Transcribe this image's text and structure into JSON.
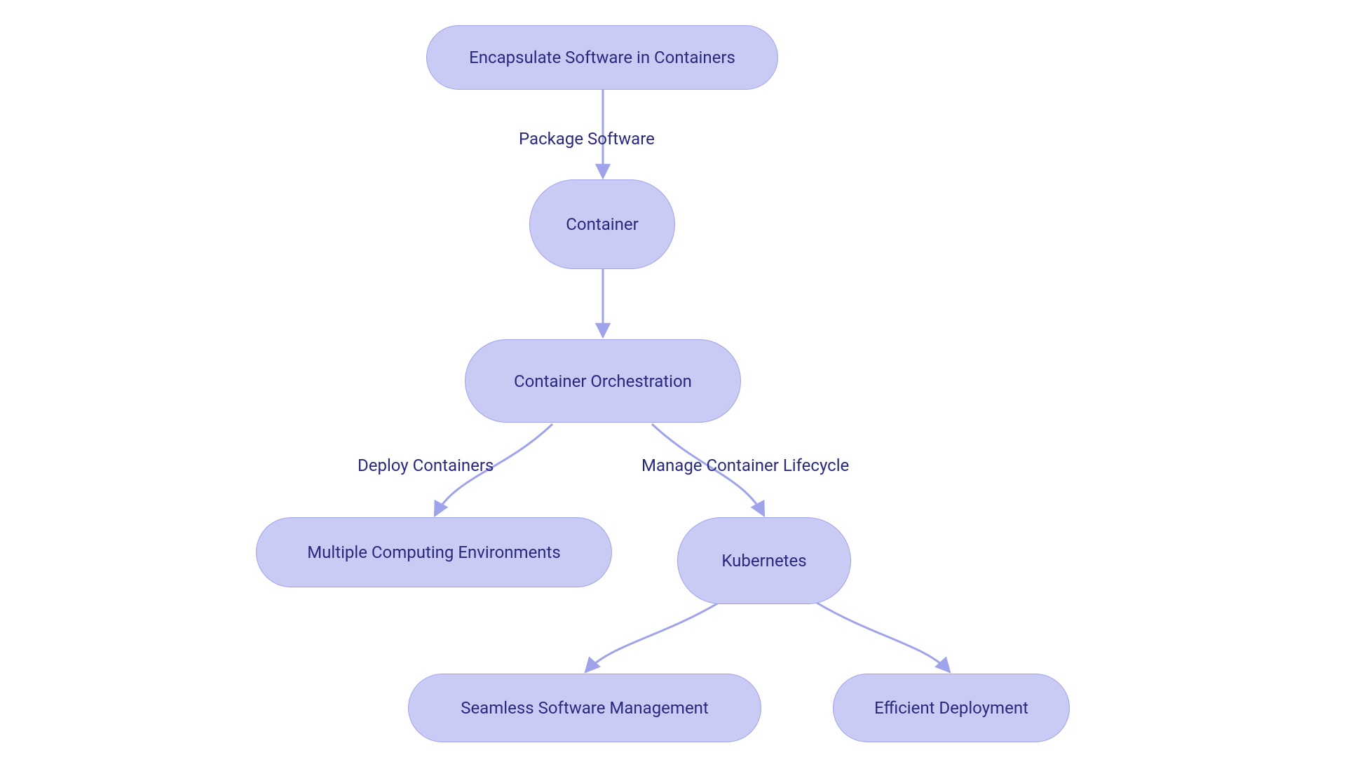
{
  "nodes": {
    "encapsulate": {
      "label": "Encapsulate Software in Containers"
    },
    "container": {
      "label": "Container"
    },
    "orchestration": {
      "label": "Container Orchestration"
    },
    "multiple_env": {
      "label": "Multiple Computing Environments"
    },
    "kubernetes": {
      "label": "Kubernetes"
    },
    "seamless": {
      "label": "Seamless Software Management"
    },
    "efficient": {
      "label": "Efficient Deployment"
    }
  },
  "edges": {
    "package_software": {
      "label": "Package Software"
    },
    "deploy_containers": {
      "label": "Deploy Containers"
    },
    "manage_lifecycle": {
      "label": "Manage Container Lifecycle"
    }
  },
  "colors": {
    "node_fill": "#c9cbf4",
    "node_stroke": "#9fa3ea",
    "text": "#28297d",
    "edge": "#9fa3ea"
  }
}
